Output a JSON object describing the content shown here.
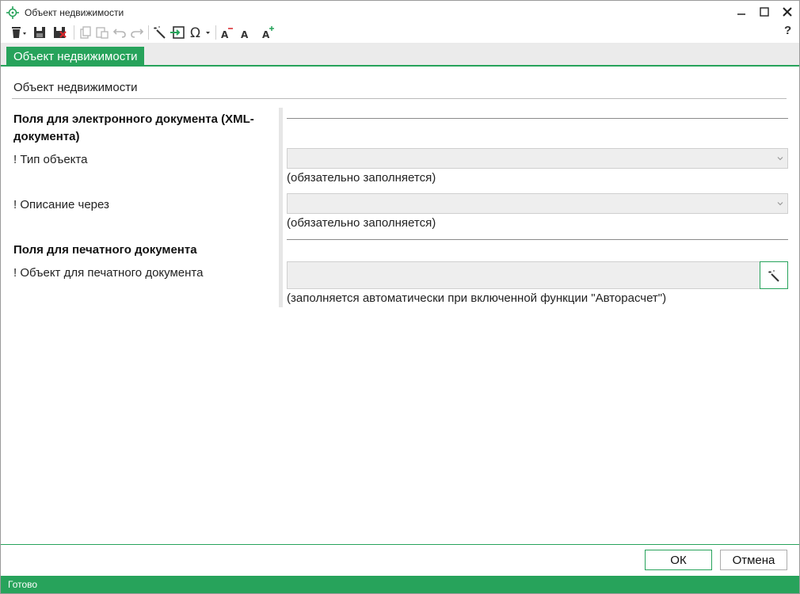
{
  "window": {
    "title": "Объект недвижимости",
    "controls": {
      "minimize": "—",
      "maximize": "☐",
      "close": "✕"
    }
  },
  "toolbar": {
    "items": [
      "delete-icon",
      "save-icon",
      "save-close-icon",
      "copy-icon",
      "paste-icon",
      "undo-icon",
      "redo-icon",
      "wand-icon",
      "insert-icon",
      "omega-icon",
      "font-decrease-icon",
      "font-reset-icon",
      "font-increase-icon"
    ],
    "help": "?"
  },
  "tabs": [
    {
      "label": "Объект недвижимости",
      "active": true
    }
  ],
  "content": {
    "section_title": "Объект недвижимости",
    "group_xml": {
      "heading_line1": "Поля для электронного документа (XML-",
      "heading_line2": "документа)"
    },
    "object_type": {
      "label": "! Тип объекта",
      "value": "",
      "hint": "(обязательно заполняется)"
    },
    "description_via": {
      "label": "! Описание через",
      "value": "",
      "hint": "(обязательно заполняется)"
    },
    "group_print": {
      "heading": "Поля для печатного документа"
    },
    "print_object": {
      "label": "! Объект для печатного документа",
      "value": "",
      "hint": "(заполняется автоматически при включенной функции \"Авторасчет\")"
    }
  },
  "footer": {
    "ok_label": "ОК",
    "cancel_label": "Отмена"
  },
  "status": {
    "text": "Готово"
  },
  "colors": {
    "accent": "#27a35b",
    "field_bg": "#eeeeee"
  }
}
